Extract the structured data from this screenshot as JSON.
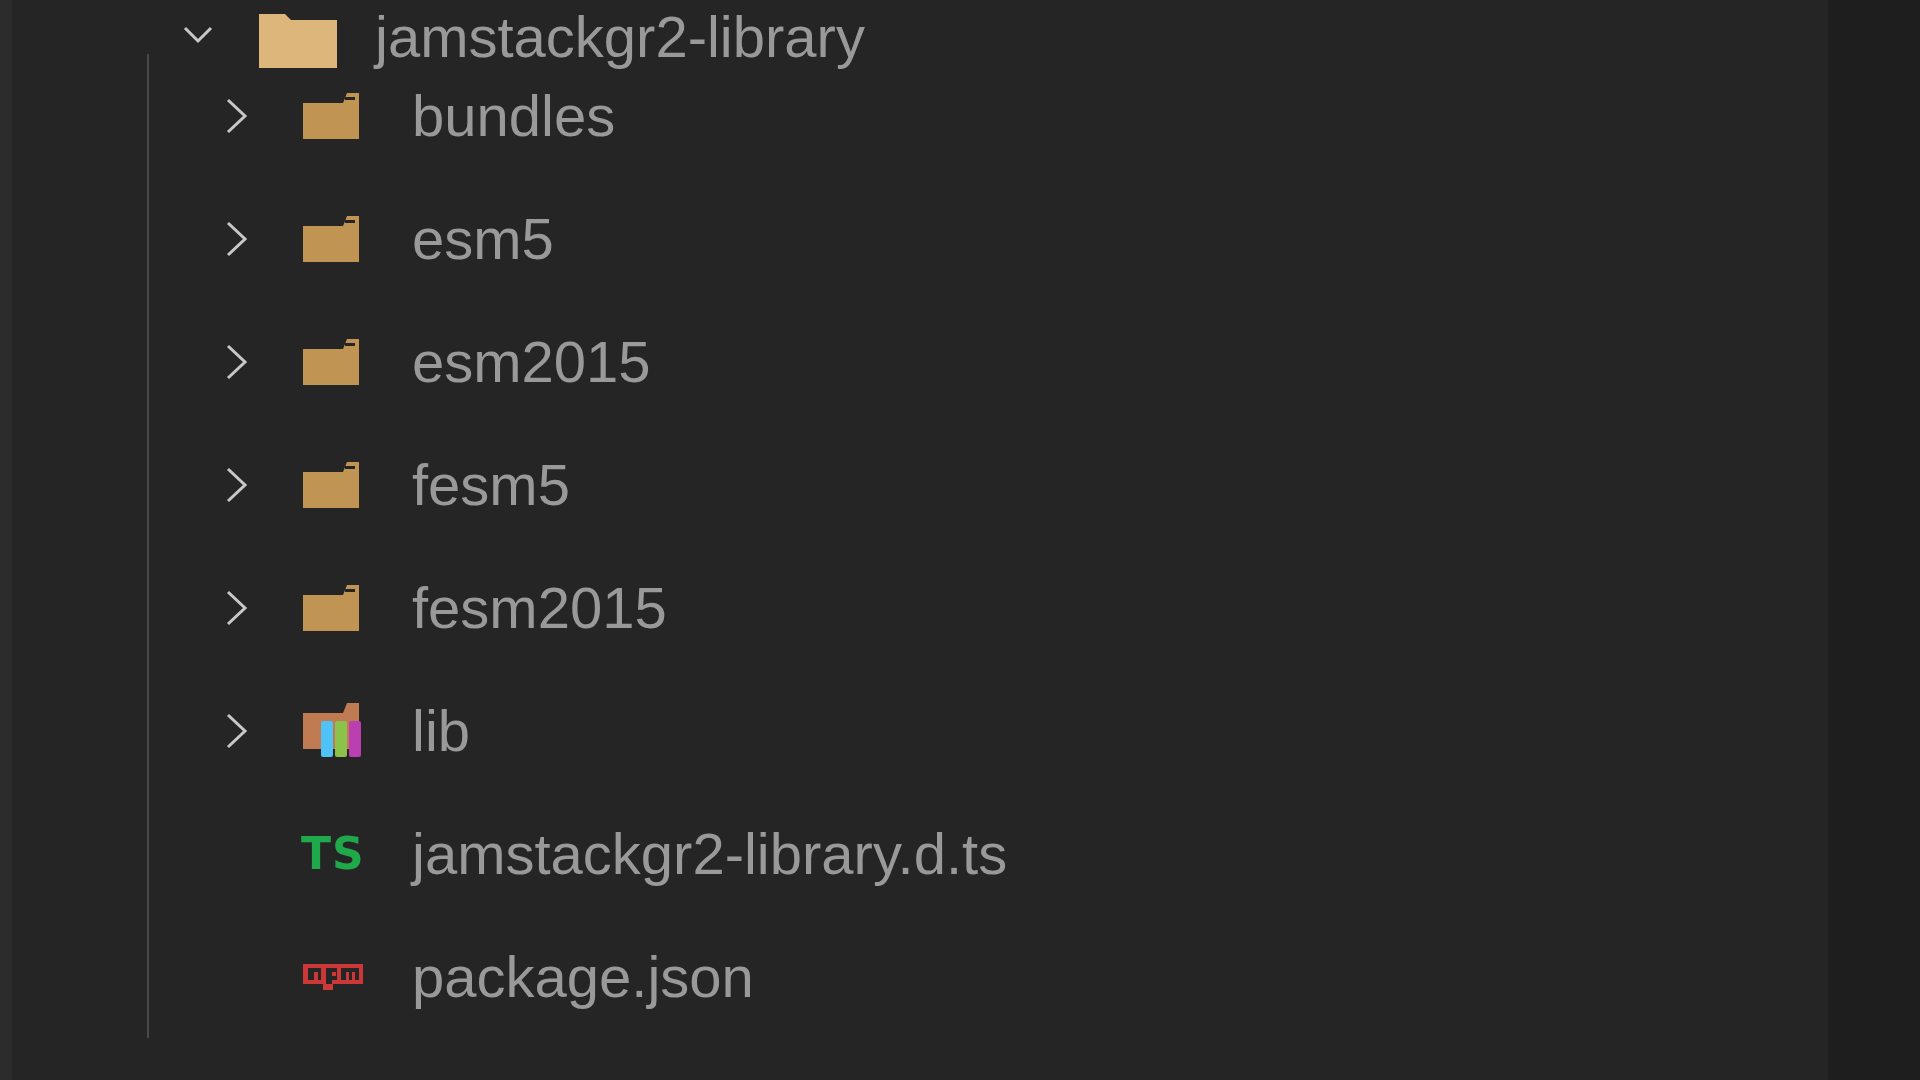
{
  "explorer": {
    "tree": [
      {
        "name": "jamstackgr2-library",
        "kind": "folder",
        "expanded": true,
        "children": [
          {
            "name": "bundles",
            "kind": "folder",
            "expanded": false
          },
          {
            "name": "esm5",
            "kind": "folder",
            "expanded": false
          },
          {
            "name": "esm2015",
            "kind": "folder",
            "expanded": false
          },
          {
            "name": "fesm5",
            "kind": "folder",
            "expanded": false
          },
          {
            "name": "fesm2015",
            "kind": "folder",
            "expanded": false
          },
          {
            "name": "lib",
            "kind": "library-folder",
            "expanded": false
          },
          {
            "name": "jamstackgr2-library.d.ts",
            "kind": "typescript",
            "badge": "TS"
          },
          {
            "name": "package.json",
            "kind": "npm"
          }
        ]
      }
    ]
  }
}
